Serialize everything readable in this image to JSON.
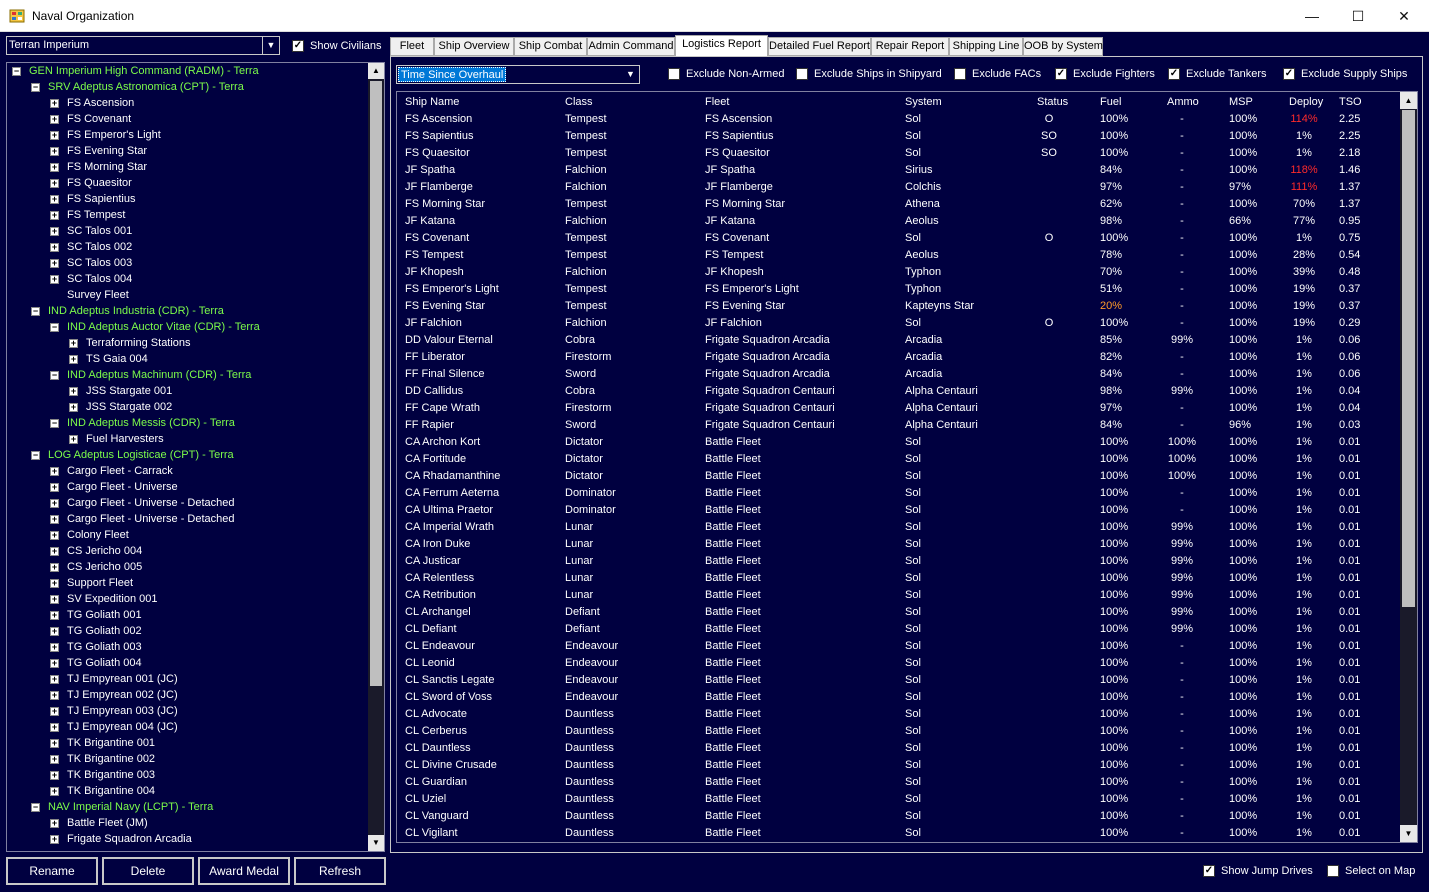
{
  "window": {
    "title": "Naval Organization",
    "minimize": "—",
    "maximize": "☐",
    "close": "✕"
  },
  "left": {
    "race": "Terran Imperium",
    "show_civilians": "Show Civilians",
    "show_civilians_checked": true,
    "tree": [
      {
        "text": "GEN Imperium High Command  (RADM)  -  Terra",
        "indent": 0,
        "color": "green",
        "exp": "-"
      },
      {
        "text": "SRV Adeptus Astronomica  (CPT)  -  Terra",
        "indent": 1,
        "color": "green",
        "exp": "-"
      },
      {
        "text": "FS Ascension",
        "indent": 2,
        "color": "white",
        "exp": "+"
      },
      {
        "text": "FS Covenant",
        "indent": 2,
        "color": "white",
        "exp": "+"
      },
      {
        "text": "FS Emperor's Light",
        "indent": 2,
        "color": "white",
        "exp": "+"
      },
      {
        "text": "FS Evening Star",
        "indent": 2,
        "color": "white",
        "exp": "+"
      },
      {
        "text": "FS Morning Star",
        "indent": 2,
        "color": "white",
        "exp": "+"
      },
      {
        "text": "FS Quaesitor",
        "indent": 2,
        "color": "white",
        "exp": "+"
      },
      {
        "text": "FS Sapientius",
        "indent": 2,
        "color": "white",
        "exp": "+"
      },
      {
        "text": "FS Tempest",
        "indent": 2,
        "color": "white",
        "exp": "+"
      },
      {
        "text": "SC Talos 001",
        "indent": 2,
        "color": "white",
        "exp": "+"
      },
      {
        "text": "SC Talos 002",
        "indent": 2,
        "color": "white",
        "exp": "+"
      },
      {
        "text": "SC Talos 003",
        "indent": 2,
        "color": "white",
        "exp": "+"
      },
      {
        "text": "SC Talos 004",
        "indent": 2,
        "color": "white",
        "exp": "+"
      },
      {
        "text": "Survey Fleet",
        "indent": 2,
        "color": "white",
        "exp": ""
      },
      {
        "text": "IND Adeptus Industria  (CDR)  -  Terra",
        "indent": 1,
        "color": "green",
        "exp": "-"
      },
      {
        "text": "IND Adeptus Auctor Vitae  (CDR)  -  Terra",
        "indent": 2,
        "color": "green",
        "exp": "-"
      },
      {
        "text": "Terraforming Stations",
        "indent": 3,
        "color": "white",
        "exp": "+"
      },
      {
        "text": "TS Gaia 004",
        "indent": 3,
        "color": "white",
        "exp": "+"
      },
      {
        "text": "IND Adeptus Machinum  (CDR)  -  Terra",
        "indent": 2,
        "color": "green",
        "exp": "-"
      },
      {
        "text": "JSS Stargate 001",
        "indent": 3,
        "color": "white",
        "exp": "+"
      },
      {
        "text": "JSS Stargate 002",
        "indent": 3,
        "color": "white",
        "exp": "+"
      },
      {
        "text": "IND Adeptus Messis  (CDR)  -  Terra",
        "indent": 2,
        "color": "green",
        "exp": "-"
      },
      {
        "text": "Fuel Harvesters",
        "indent": 3,
        "color": "white",
        "exp": "+"
      },
      {
        "text": "LOG Adeptus Logisticae  (CPT)  -  Terra",
        "indent": 1,
        "color": "green",
        "exp": "-"
      },
      {
        "text": "Cargo Fleet - Carrack",
        "indent": 2,
        "color": "white",
        "exp": "+"
      },
      {
        "text": "Cargo Fleet - Universe",
        "indent": 2,
        "color": "white",
        "exp": "+"
      },
      {
        "text": "Cargo Fleet - Universe - Detached",
        "indent": 2,
        "color": "white",
        "exp": "+"
      },
      {
        "text": "Cargo Fleet - Universe - Detached",
        "indent": 2,
        "color": "white",
        "exp": "+"
      },
      {
        "text": "Colony Fleet",
        "indent": 2,
        "color": "white",
        "exp": "+"
      },
      {
        "text": "CS Jericho 004",
        "indent": 2,
        "color": "white",
        "exp": "+"
      },
      {
        "text": "CS Jericho 005",
        "indent": 2,
        "color": "white",
        "exp": "+"
      },
      {
        "text": "Support Fleet",
        "indent": 2,
        "color": "white",
        "exp": "+"
      },
      {
        "text": "SV Expedition 001",
        "indent": 2,
        "color": "white",
        "exp": "+"
      },
      {
        "text": "TG Goliath 001",
        "indent": 2,
        "color": "white",
        "exp": "+"
      },
      {
        "text": "TG Goliath 002",
        "indent": 2,
        "color": "white",
        "exp": "+"
      },
      {
        "text": "TG Goliath 003",
        "indent": 2,
        "color": "white",
        "exp": "+"
      },
      {
        "text": "TG Goliath 004",
        "indent": 2,
        "color": "white",
        "exp": "+"
      },
      {
        "text": "TJ Empyrean 001  (JC)",
        "indent": 2,
        "color": "white",
        "exp": "+"
      },
      {
        "text": "TJ Empyrean 002  (JC)",
        "indent": 2,
        "color": "white",
        "exp": "+"
      },
      {
        "text": "TJ Empyrean 003  (JC)",
        "indent": 2,
        "color": "white",
        "exp": "+"
      },
      {
        "text": "TJ Empyrean 004  (JC)",
        "indent": 2,
        "color": "white",
        "exp": "+"
      },
      {
        "text": "TK Brigantine 001",
        "indent": 2,
        "color": "white",
        "exp": "+"
      },
      {
        "text": "TK Brigantine 002",
        "indent": 2,
        "color": "white",
        "exp": "+"
      },
      {
        "text": "TK Brigantine 003",
        "indent": 2,
        "color": "white",
        "exp": "+"
      },
      {
        "text": "TK Brigantine 004",
        "indent": 2,
        "color": "white",
        "exp": "+"
      },
      {
        "text": "NAV Imperial Navy  (LCPT)  -  Terra",
        "indent": 1,
        "color": "green",
        "exp": "-"
      },
      {
        "text": "Battle Fleet  (JM)",
        "indent": 2,
        "color": "white",
        "exp": "+"
      },
      {
        "text": "Frigate Squadron Arcadia",
        "indent": 2,
        "color": "white",
        "exp": "+"
      }
    ],
    "buttons": {
      "rename": "Rename",
      "delete": "Delete",
      "award": "Award Medal",
      "refresh": "Refresh"
    }
  },
  "tabs": [
    "Fleet",
    "Ship Overview",
    "Ship Combat",
    "Admin Command",
    "Logistics Report",
    "Detailed Fuel Report",
    "Repair Report",
    "Shipping Line",
    "OOB by System"
  ],
  "active_tab": 4,
  "report": {
    "sort_by": "Time Since Overhaul",
    "filters": [
      {
        "label": "Exclude Non-Armed",
        "checked": false
      },
      {
        "label": "Exclude Ships in Shipyard",
        "checked": false
      },
      {
        "label": "Exclude FACs",
        "checked": false
      },
      {
        "label": "Exclude Fighters",
        "checked": true
      },
      {
        "label": "Exclude Tankers",
        "checked": true
      },
      {
        "label": "Exclude Supply Ships",
        "checked": true
      }
    ],
    "columns": [
      "Ship Name",
      "Class",
      "Fleet",
      "System",
      "Status",
      "Fuel",
      "Ammo",
      "MSP",
      "Deploy",
      "TSO"
    ],
    "rows": [
      [
        "FS Ascension",
        "Tempest",
        "FS Ascension",
        "Sol",
        "O",
        "100%",
        "-",
        "100%",
        "114%",
        "2.25"
      ],
      [
        "FS Sapientius",
        "Tempest",
        "FS Sapientius",
        "Sol",
        "SO",
        "100%",
        "-",
        "100%",
        "1%",
        "2.25"
      ],
      [
        "FS Quaesitor",
        "Tempest",
        "FS Quaesitor",
        "Sol",
        "SO",
        "100%",
        "-",
        "100%",
        "1%",
        "2.18"
      ],
      [
        "JF Spatha",
        "Falchion",
        "JF Spatha",
        "Sirius",
        "",
        "84%",
        "-",
        "100%",
        "118%",
        "1.46"
      ],
      [
        "JF Flamberge",
        "Falchion",
        "JF Flamberge",
        "Colchis",
        "",
        "97%",
        "-",
        "97%",
        "111%",
        "1.37"
      ],
      [
        "FS Morning Star",
        "Tempest",
        "FS Morning Star",
        "Athena",
        "",
        "62%",
        "-",
        "100%",
        "70%",
        "1.37"
      ],
      [
        "JF Katana",
        "Falchion",
        "JF Katana",
        "Aeolus",
        "",
        "98%",
        "-",
        "66%",
        "77%",
        "0.95"
      ],
      [
        "FS Covenant",
        "Tempest",
        "FS Covenant",
        "Sol",
        "O",
        "100%",
        "-",
        "100%",
        "1%",
        "0.75"
      ],
      [
        "FS Tempest",
        "Tempest",
        "FS Tempest",
        "Aeolus",
        "",
        "78%",
        "-",
        "100%",
        "28%",
        "0.54"
      ],
      [
        "JF Khopesh",
        "Falchion",
        "JF Khopesh",
        "Typhon",
        "",
        "70%",
        "-",
        "100%",
        "39%",
        "0.48"
      ],
      [
        "FS Emperor's Light",
        "Tempest",
        "FS Emperor's Light",
        "Typhon",
        "",
        "51%",
        "-",
        "100%",
        "19%",
        "0.37"
      ],
      [
        "FS Evening Star",
        "Tempest",
        "FS Evening Star",
        "Kapteyns Star",
        "",
        "20%",
        "-",
        "100%",
        "19%",
        "0.37"
      ],
      [
        "JF Falchion",
        "Falchion",
        "JF Falchion",
        "Sol",
        "O",
        "100%",
        "-",
        "100%",
        "19%",
        "0.29"
      ],
      [
        "DD Valour Eternal",
        "Cobra",
        "Frigate Squadron Arcadia",
        "Arcadia",
        "",
        "85%",
        "99%",
        "100%",
        "1%",
        "0.06"
      ],
      [
        "FF Liberator",
        "Firestorm",
        "Frigate Squadron Arcadia",
        "Arcadia",
        "",
        "82%",
        "-",
        "100%",
        "1%",
        "0.06"
      ],
      [
        "FF Final Silence",
        "Sword",
        "Frigate Squadron Arcadia",
        "Arcadia",
        "",
        "84%",
        "-",
        "100%",
        "1%",
        "0.06"
      ],
      [
        "DD Callidus",
        "Cobra",
        "Frigate Squadron Centauri",
        "Alpha Centauri",
        "",
        "98%",
        "99%",
        "100%",
        "1%",
        "0.04"
      ],
      [
        "FF Cape Wrath",
        "Firestorm",
        "Frigate Squadron Centauri",
        "Alpha Centauri",
        "",
        "97%",
        "-",
        "100%",
        "1%",
        "0.04"
      ],
      [
        "FF Rapier",
        "Sword",
        "Frigate Squadron Centauri",
        "Alpha Centauri",
        "",
        "84%",
        "-",
        "96%",
        "1%",
        "0.03"
      ],
      [
        "CA Archon Kort",
        "Dictator",
        "Battle Fleet",
        "Sol",
        "",
        "100%",
        "100%",
        "100%",
        "1%",
        "0.01"
      ],
      [
        "CA Fortitude",
        "Dictator",
        "Battle Fleet",
        "Sol",
        "",
        "100%",
        "100%",
        "100%",
        "1%",
        "0.01"
      ],
      [
        "CA Rhadamanthine",
        "Dictator",
        "Battle Fleet",
        "Sol",
        "",
        "100%",
        "100%",
        "100%",
        "1%",
        "0.01"
      ],
      [
        "CA Ferrum Aeterna",
        "Dominator",
        "Battle Fleet",
        "Sol",
        "",
        "100%",
        "-",
        "100%",
        "1%",
        "0.01"
      ],
      [
        "CA Ultima Praetor",
        "Dominator",
        "Battle Fleet",
        "Sol",
        "",
        "100%",
        "-",
        "100%",
        "1%",
        "0.01"
      ],
      [
        "CA Imperial Wrath",
        "Lunar",
        "Battle Fleet",
        "Sol",
        "",
        "100%",
        "99%",
        "100%",
        "1%",
        "0.01"
      ],
      [
        "CA Iron Duke",
        "Lunar",
        "Battle Fleet",
        "Sol",
        "",
        "100%",
        "99%",
        "100%",
        "1%",
        "0.01"
      ],
      [
        "CA Justicar",
        "Lunar",
        "Battle Fleet",
        "Sol",
        "",
        "100%",
        "99%",
        "100%",
        "1%",
        "0.01"
      ],
      [
        "CA Relentless",
        "Lunar",
        "Battle Fleet",
        "Sol",
        "",
        "100%",
        "99%",
        "100%",
        "1%",
        "0.01"
      ],
      [
        "CA Retribution",
        "Lunar",
        "Battle Fleet",
        "Sol",
        "",
        "100%",
        "99%",
        "100%",
        "1%",
        "0.01"
      ],
      [
        "CL Archangel",
        "Defiant",
        "Battle Fleet",
        "Sol",
        "",
        "100%",
        "99%",
        "100%",
        "1%",
        "0.01"
      ],
      [
        "CL Defiant",
        "Defiant",
        "Battle Fleet",
        "Sol",
        "",
        "100%",
        "99%",
        "100%",
        "1%",
        "0.01"
      ],
      [
        "CL Endeavour",
        "Endeavour",
        "Battle Fleet",
        "Sol",
        "",
        "100%",
        "-",
        "100%",
        "1%",
        "0.01"
      ],
      [
        "CL Leonid",
        "Endeavour",
        "Battle Fleet",
        "Sol",
        "",
        "100%",
        "-",
        "100%",
        "1%",
        "0.01"
      ],
      [
        "CL Sanctis Legate",
        "Endeavour",
        "Battle Fleet",
        "Sol",
        "",
        "100%",
        "-",
        "100%",
        "1%",
        "0.01"
      ],
      [
        "CL Sword of Voss",
        "Endeavour",
        "Battle Fleet",
        "Sol",
        "",
        "100%",
        "-",
        "100%",
        "1%",
        "0.01"
      ],
      [
        "CL Advocate",
        "Dauntless",
        "Battle Fleet",
        "Sol",
        "",
        "100%",
        "-",
        "100%",
        "1%",
        "0.01"
      ],
      [
        "CL Cerberus",
        "Dauntless",
        "Battle Fleet",
        "Sol",
        "",
        "100%",
        "-",
        "100%",
        "1%",
        "0.01"
      ],
      [
        "CL Dauntless",
        "Dauntless",
        "Battle Fleet",
        "Sol",
        "",
        "100%",
        "-",
        "100%",
        "1%",
        "0.01"
      ],
      [
        "CL Divine Crusade",
        "Dauntless",
        "Battle Fleet",
        "Sol",
        "",
        "100%",
        "-",
        "100%",
        "1%",
        "0.01"
      ],
      [
        "CL Guardian",
        "Dauntless",
        "Battle Fleet",
        "Sol",
        "",
        "100%",
        "-",
        "100%",
        "1%",
        "0.01"
      ],
      [
        "CL Uziel",
        "Dauntless",
        "Battle Fleet",
        "Sol",
        "",
        "100%",
        "-",
        "100%",
        "1%",
        "0.01"
      ],
      [
        "CL Vanguard",
        "Dauntless",
        "Battle Fleet",
        "Sol",
        "",
        "100%",
        "-",
        "100%",
        "1%",
        "0.01"
      ],
      [
        "CL Vigilant",
        "Dauntless",
        "Battle Fleet",
        "Sol",
        "",
        "100%",
        "-",
        "100%",
        "1%",
        "0.01"
      ]
    ],
    "highlights": [
      {
        "row": 0,
        "col": 8,
        "color": "#ff2a2a"
      },
      {
        "row": 3,
        "col": 8,
        "color": "#ff2a2a"
      },
      {
        "row": 4,
        "col": 8,
        "color": "#ff2a2a"
      },
      {
        "row": 11,
        "col": 5,
        "color": "#ff9a2a"
      }
    ]
  },
  "bottom": {
    "show_jump_drives": "Show Jump Drives",
    "show_jump_drives_checked": true,
    "select_on_map": "Select on Map",
    "select_on_map_checked": false
  },
  "colors": {
    "background": "#000040",
    "group_text": "#7cfc4a",
    "warning_red": "#ff2a2a",
    "warning_orange": "#ff9a2a"
  }
}
